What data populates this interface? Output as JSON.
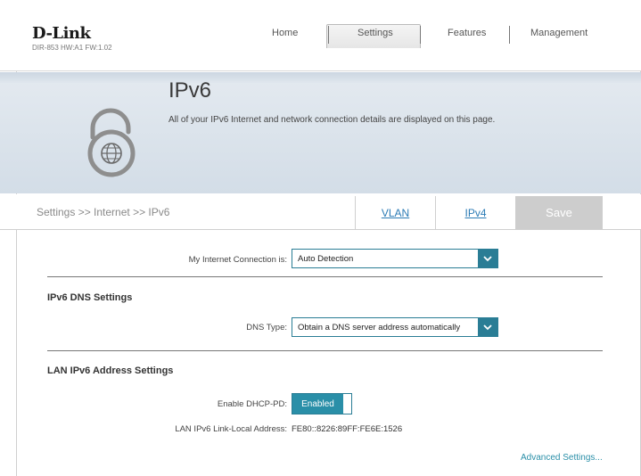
{
  "header": {
    "logo": "D-Link",
    "model": "DIR-853 HW:A1 FW:1.02",
    "nav": [
      {
        "label": "Home"
      },
      {
        "label": "Settings"
      },
      {
        "label": "Features"
      },
      {
        "label": "Management"
      }
    ],
    "active_nav": "Settings"
  },
  "banner": {
    "title": "IPv6",
    "description": "All of your IPv6 Internet and network connection details are displayed on this page.",
    "icon": "lock-globe-icon"
  },
  "breadcrumb": {
    "path": "Settings >> Internet >> IPv6",
    "tabs": [
      {
        "label": "VLAN"
      },
      {
        "label": "IPv4"
      }
    ],
    "save_label": "Save"
  },
  "connection": {
    "label": "My Internet Connection is:",
    "value": "Auto Detection"
  },
  "dns": {
    "section_title": "IPv6 DNS Settings",
    "label": "DNS Type:",
    "value": "Obtain a DNS server address automatically"
  },
  "lan": {
    "section_title": "LAN IPv6 Address Settings",
    "dhcp_label": "Enable DHCP-PD:",
    "dhcp_value": "Enabled",
    "link_local_label": "LAN IPv6 Link-Local Address:",
    "link_local_value": "FE80::8226:89FF:FE6E:1526"
  },
  "advanced_link": "Advanced Settings...",
  "colors": {
    "accent": "#2a8fa8",
    "border": "#2a7d95",
    "link": "#2b7bb5",
    "save_bg": "#cdcdcd"
  }
}
